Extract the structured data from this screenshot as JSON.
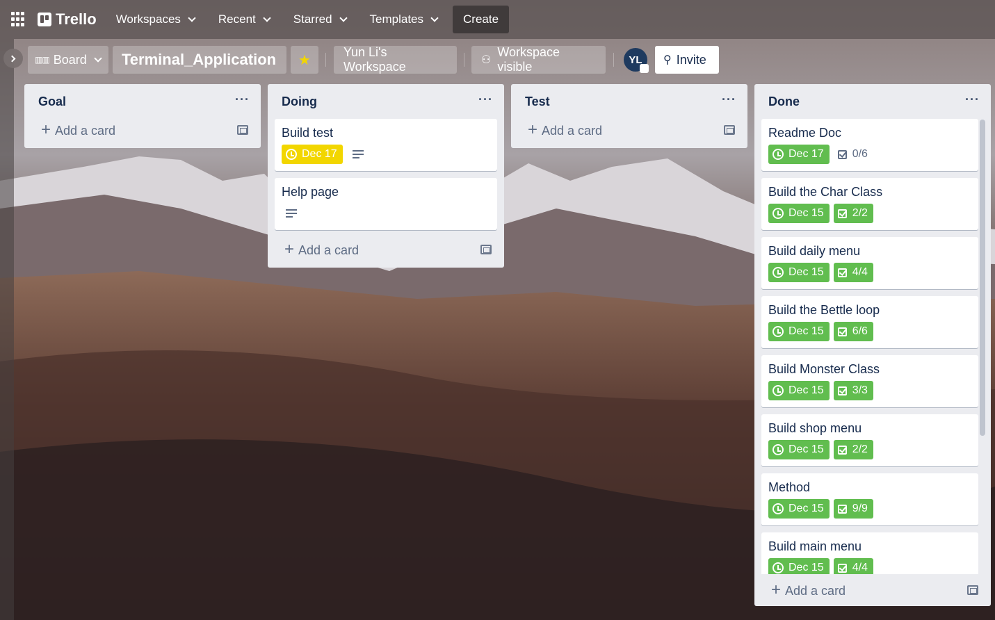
{
  "nav": {
    "app_name": "Trello",
    "workspaces": "Workspaces",
    "recent": "Recent",
    "starred": "Starred",
    "templates": "Templates",
    "create": "Create"
  },
  "board": {
    "view": "Board",
    "title": "Terminal_Application",
    "workspace": "Yun Li's Workspace",
    "visibility": "Workspace visible",
    "avatar_initials": "YL",
    "invite": "Invite"
  },
  "lists": [
    {
      "title": "Goal",
      "add_label": "Add a card",
      "cards": []
    },
    {
      "title": "Doing",
      "add_label": "Add a card",
      "cards": [
        {
          "title": "Build test",
          "due": "Dec 17",
          "due_color": "yellow",
          "description": true
        },
        {
          "title": "Help page",
          "description": true
        }
      ]
    },
    {
      "title": "Test",
      "add_label": "Add a card",
      "cards": []
    },
    {
      "title": "Done",
      "add_label": "Add a card",
      "cards": [
        {
          "title": "Readme Doc",
          "due": "Dec 17",
          "checklist": "0/6"
        },
        {
          "title": "Build the Char Class",
          "due": "Dec 15",
          "checklist": "2/2"
        },
        {
          "title": "Build daily menu",
          "due": "Dec 15",
          "checklist": "4/4"
        },
        {
          "title": "Build the Bettle loop",
          "due": "Dec 15",
          "checklist": "6/6"
        },
        {
          "title": "Build Monster Class",
          "due": "Dec 15",
          "checklist": "3/3"
        },
        {
          "title": "Build shop menu",
          "due": "Dec 15",
          "checklist": "2/2"
        },
        {
          "title": "Method",
          "due": "Dec 15",
          "checklist": "9/9"
        },
        {
          "title": "Build main menu",
          "due": "Dec 15",
          "checklist": "4/4"
        }
      ]
    }
  ],
  "colors": {
    "green": "#61bd4f",
    "yellow": "#f2d600",
    "list_bg": "#ebecf0"
  }
}
